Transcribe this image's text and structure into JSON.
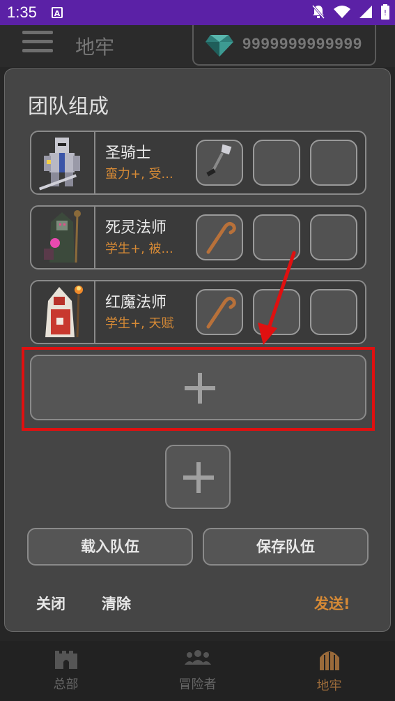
{
  "status_bar": {
    "time": "1:35",
    "notification_badge": "A"
  },
  "app_bar": {
    "title": "地牢",
    "gems": "9999999999999"
  },
  "dialog": {
    "title": "团队组成",
    "members": [
      {
        "name": "圣骑士",
        "traits": "蛮力+, 受...",
        "slots": [
          "shovel",
          "",
          ""
        ]
      },
      {
        "name": "死灵法师",
        "traits": "学生+, 被...",
        "slots": [
          "staff",
          "",
          ""
        ]
      },
      {
        "name": "红魔法师",
        "traits": "学生+, 天赋",
        "slots": [
          "staff",
          "",
          ""
        ]
      }
    ],
    "load_team": "载入队伍",
    "save_team": "保存队伍",
    "close": "关闭",
    "clear": "清除",
    "send": "发送!"
  },
  "bottom_nav": [
    {
      "label": "总部",
      "icon": "castle-icon"
    },
    {
      "label": "冒险者",
      "icon": "people-icon"
    },
    {
      "label": "地牢",
      "icon": "dungeon-gate-icon",
      "active": true
    }
  ],
  "colors": {
    "status_bar": "#5b21a6",
    "accent": "#d68a36",
    "highlight": "#e01010"
  }
}
